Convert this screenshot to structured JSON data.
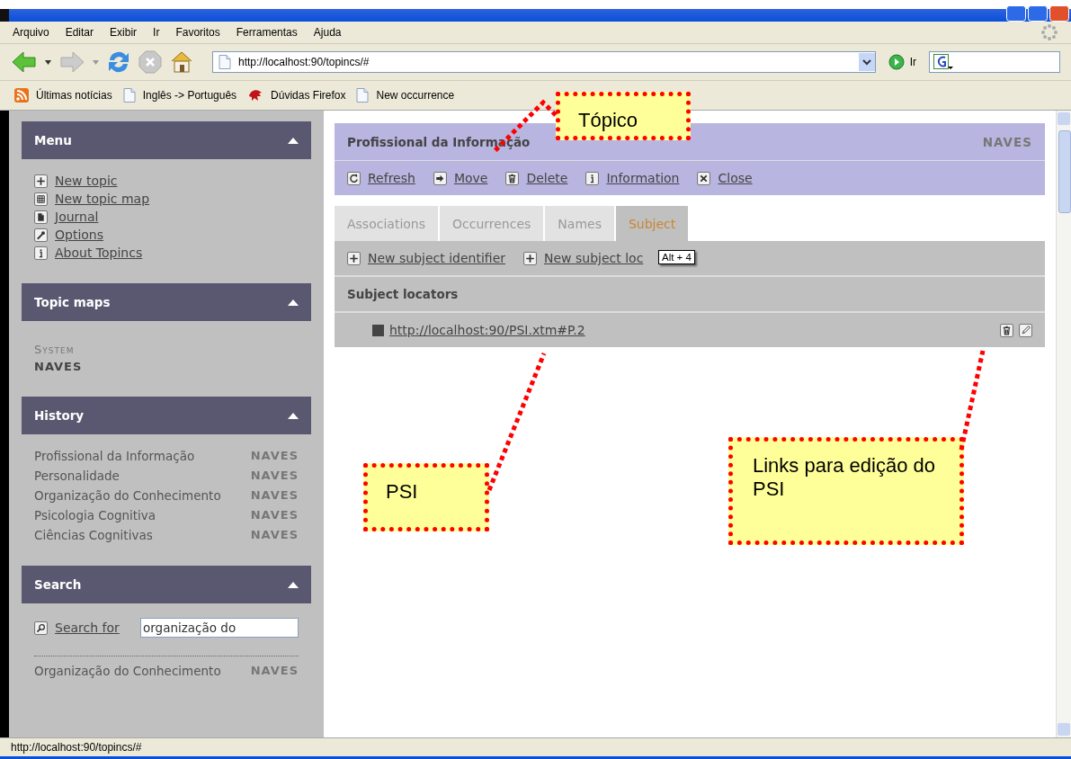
{
  "menu_bar": [
    "Arquivo",
    "Editar",
    "Exibir",
    "Ir",
    "Favoritos",
    "Ferramentas",
    "Ajuda"
  ],
  "address_bar": {
    "value": "http://localhost:90/topincs/#",
    "go_label": "Ir"
  },
  "bookmarks": [
    {
      "kind": "feed",
      "label": "Últimas notícias"
    },
    {
      "kind": "page",
      "label": "Inglês -> Português"
    },
    {
      "kind": "creature",
      "label": "Dúvidas Firefox"
    },
    {
      "kind": "page",
      "label": "New occurrence"
    }
  ],
  "sidebar": {
    "menu": {
      "title": "Menu",
      "items": [
        {
          "kind": "plus",
          "label": "New topic"
        },
        {
          "kind": "grid",
          "label": "New topic map"
        },
        {
          "kind": "page",
          "label": "Journal"
        },
        {
          "kind": "wrench",
          "label": "Options"
        },
        {
          "kind": "info",
          "label": "About Topincs"
        }
      ]
    },
    "topic_maps": {
      "title": "Topic maps",
      "groups": [
        {
          "heading": "System",
          "items": [
            "NAVES"
          ]
        }
      ]
    },
    "history": {
      "title": "History",
      "items": [
        {
          "label": "Profissional da Informação",
          "map": "NAVES"
        },
        {
          "label": "Personalidade",
          "map": "NAVES"
        },
        {
          "label": "Organização do Conhecimento",
          "map": "NAVES"
        },
        {
          "label": "Psicologia Cognitiva",
          "map": "NAVES"
        },
        {
          "label": "Ciências Cognitivas",
          "map": "NAVES"
        }
      ]
    },
    "search": {
      "title": "Search",
      "button": "Search for",
      "value": "organização do",
      "results": [
        {
          "label": "Organização do Conhecimento",
          "map": "NAVES"
        }
      ]
    }
  },
  "topic": {
    "title": "Profissional da Informação",
    "map": "NAVES",
    "actions": [
      {
        "kind": "refresh",
        "label": "Refresh"
      },
      {
        "kind": "move",
        "label": "Move"
      },
      {
        "kind": "trash",
        "label": "Delete"
      },
      {
        "kind": "info",
        "label": "Information"
      },
      {
        "kind": "close",
        "label": "Close"
      }
    ],
    "tabs": [
      {
        "label": "Associations",
        "selected": false
      },
      {
        "label": "Occurrences",
        "selected": false
      },
      {
        "label": "Names",
        "selected": false
      },
      {
        "label": "Subject",
        "selected": true
      }
    ],
    "subject_actions": [
      {
        "kind": "plus",
        "label": "New subject identifier"
      },
      {
        "kind": "plus",
        "label": "New subject loc"
      }
    ],
    "tooltip": "Alt + 4",
    "section_title": "Subject locators",
    "locators": [
      "http://localhost:90/PSI.xtm#P.2"
    ]
  },
  "callouts": [
    {
      "text": "Tópico"
    },
    {
      "text": "PSI"
    },
    {
      "text": "Links para edição do PSI"
    }
  ],
  "status_bar": "http://localhost:90/topincs/#"
}
